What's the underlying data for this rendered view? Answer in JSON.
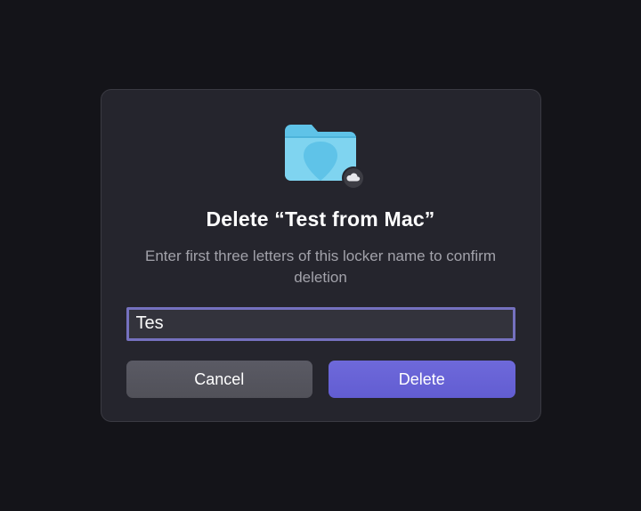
{
  "dialog": {
    "title": "Delete “Test from Mac”",
    "subtitle": "Enter first three letters of this locker name to confirm deletion",
    "input_value": "Tes",
    "cancel_label": "Cancel",
    "delete_label": "Delete"
  },
  "icon": {
    "name": "folder-icon",
    "badge": "cloud-icon"
  },
  "colors": {
    "accent": "#6863d6",
    "focus_ring": "#7571bf",
    "dialog_bg": "#25252d",
    "page_bg": "#141419"
  }
}
